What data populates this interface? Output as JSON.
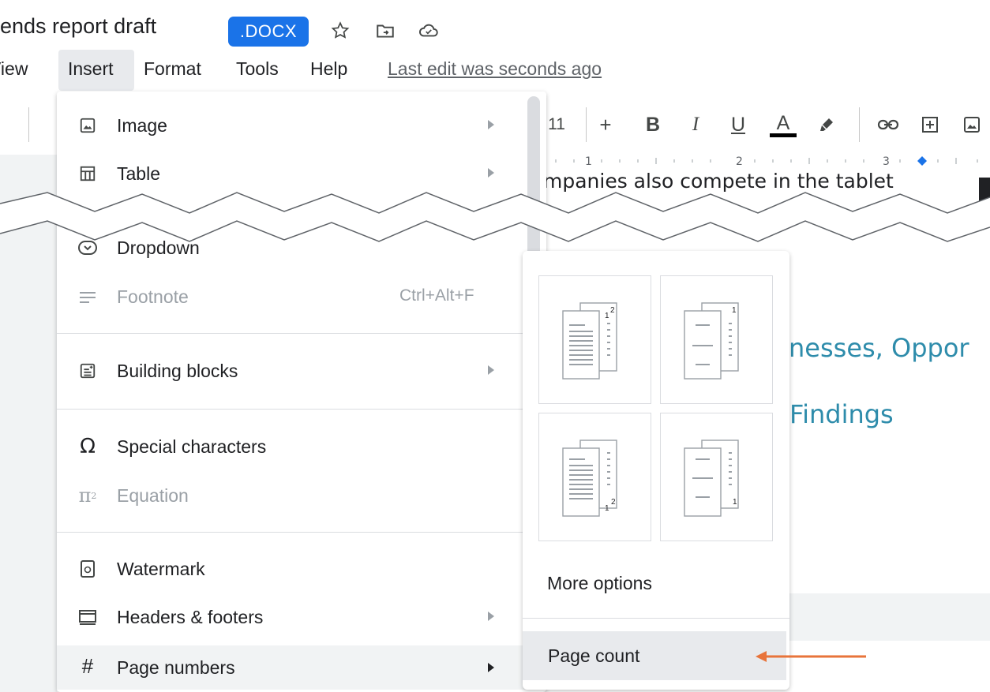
{
  "title_bar": {
    "doc_title": "ends report draft",
    "file_type_badge": ".DOCX"
  },
  "menu_bar": {
    "view": "View",
    "insert": "Insert",
    "format": "Format",
    "tools": "Tools",
    "help": "Help",
    "last_edit": "Last edit was seconds ago"
  },
  "toolbar": {
    "font_size": "11",
    "increase_font": "+",
    "bold": "B",
    "italic": "I",
    "underline": "U",
    "text_color": "A"
  },
  "ruler": {
    "marks": [
      "1",
      "2",
      "3"
    ]
  },
  "document": {
    "body_text": "mpanies also compete in the tablet",
    "heading_1": "nesses, Oppor",
    "heading_2": "Findings"
  },
  "insert_menu": {
    "items": [
      {
        "label": "Image",
        "icon": "image-icon",
        "submenu": true
      },
      {
        "label": "Table",
        "icon": "table-icon",
        "submenu": true
      },
      {
        "label": "Dropdown",
        "icon": "dropdown-icon",
        "submenu": false
      },
      {
        "label": "Footnote",
        "icon": "footnote-icon",
        "shortcut": "Ctrl+Alt+F",
        "disabled": true
      },
      {
        "label": "Building blocks",
        "icon": "building-blocks-icon",
        "submenu": true
      },
      {
        "label": "Special characters",
        "icon": "omega-icon",
        "submenu": false
      },
      {
        "label": "Equation",
        "icon": "pi-icon",
        "disabled": true
      },
      {
        "label": "Watermark",
        "icon": "watermark-icon",
        "submenu": false
      },
      {
        "label": "Headers & footers",
        "icon": "headers-footers-icon",
        "submenu": true
      },
      {
        "label": "Page numbers",
        "icon": "hash-icon",
        "submenu": true,
        "active": true
      }
    ]
  },
  "page_numbers_submenu": {
    "options": [
      {
        "page_labels": [
          "1",
          "2"
        ],
        "position": "top-right, skip first"
      },
      {
        "page_labels": [
          "1"
        ],
        "position": "top-right"
      },
      {
        "page_labels": [
          "1",
          "2"
        ],
        "position": "bottom-right"
      },
      {
        "page_labels": [
          "1"
        ],
        "position": "bottom-right, skip first"
      }
    ],
    "more_options": "More options",
    "page_count": "Page count"
  },
  "colors": {
    "accent_blue": "#1a73e8",
    "heading_teal": "#2e8cab",
    "annotation_arrow": "#e8743b"
  }
}
